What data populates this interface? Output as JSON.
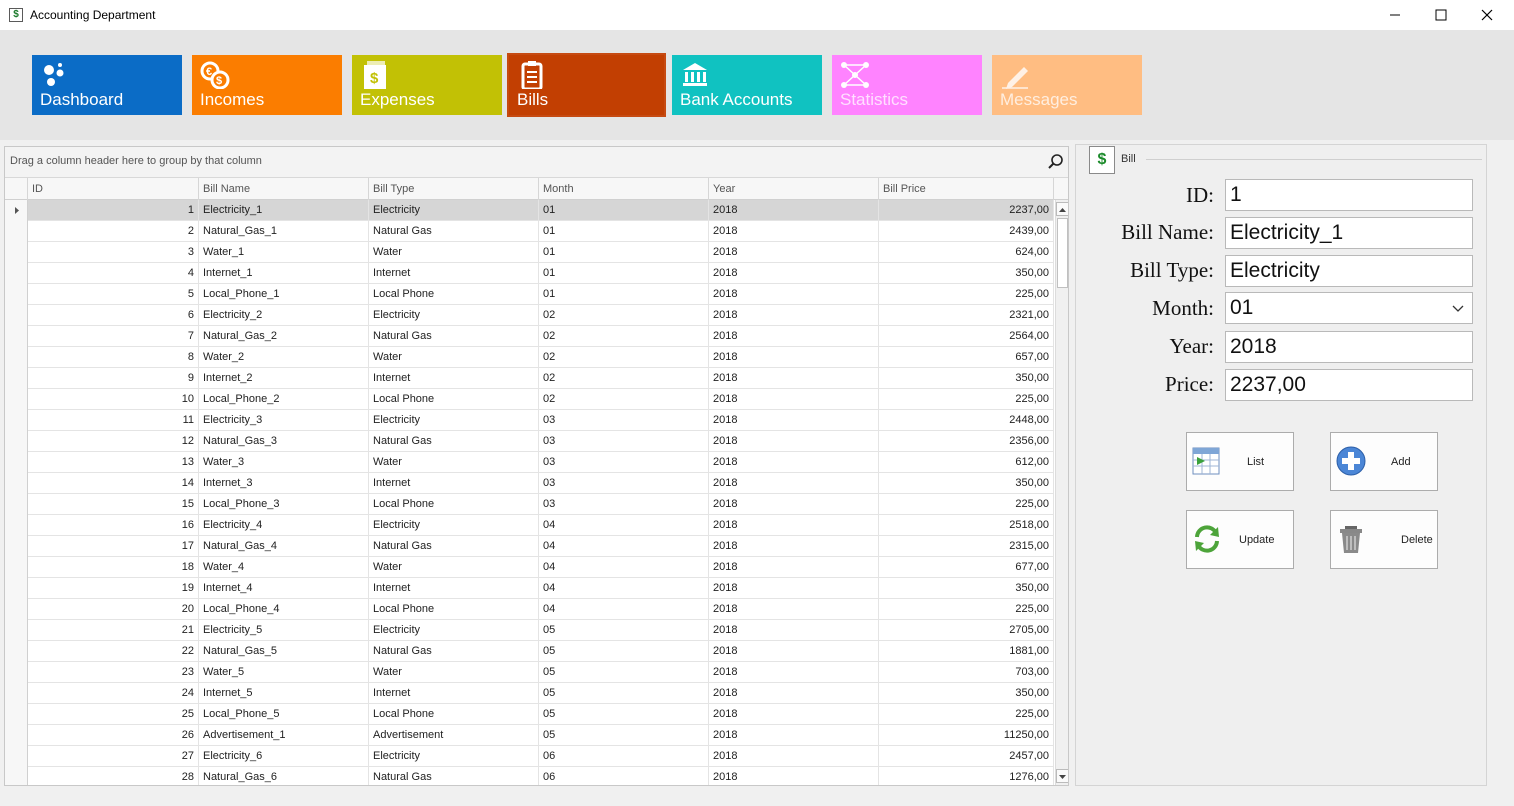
{
  "window": {
    "title": "Accounting Department",
    "icon_glyph": "$"
  },
  "nav": {
    "tiles": [
      {
        "label": "Dashboard",
        "color": "#0b6cc6",
        "icon": "dots-icon"
      },
      {
        "label": "Incomes",
        "color": "#fb7d00",
        "icon": "coins-icon"
      },
      {
        "label": "Expenses",
        "color": "#c2c105",
        "icon": "money-doc-icon"
      },
      {
        "label": "Bills",
        "color": "#c23f02",
        "icon": "clipboard-icon",
        "selected": true
      },
      {
        "label": "Bank Accounts",
        "color": "#10c2c1",
        "icon": "bank-icon"
      },
      {
        "label": "Statistics",
        "color": "#ff83ff",
        "icon": "network-icon"
      },
      {
        "label": "Messages",
        "color": "#ffbd82",
        "icon": "pencil-icon"
      }
    ]
  },
  "grid": {
    "group_panel_text": "Drag a column header here to group by that column",
    "columns": [
      "ID",
      "Bill Name",
      "Bill Type",
      "Month",
      "Year",
      "Bill Price"
    ],
    "rows": [
      [
        "1",
        "Electricity_1",
        "Electricity",
        "01",
        "2018",
        "2237,00"
      ],
      [
        "2",
        "Natural_Gas_1",
        "Natural Gas",
        "01",
        "2018",
        "2439,00"
      ],
      [
        "3",
        "Water_1",
        "Water",
        "01",
        "2018",
        "624,00"
      ],
      [
        "4",
        "Internet_1",
        "Internet",
        "01",
        "2018",
        "350,00"
      ],
      [
        "5",
        "Local_Phone_1",
        "Local Phone",
        "01",
        "2018",
        "225,00"
      ],
      [
        "6",
        "Electricity_2",
        "Electricity",
        "02",
        "2018",
        "2321,00"
      ],
      [
        "7",
        "Natural_Gas_2",
        "Natural Gas",
        "02",
        "2018",
        "2564,00"
      ],
      [
        "8",
        "Water_2",
        "Water",
        "02",
        "2018",
        "657,00"
      ],
      [
        "9",
        "Internet_2",
        "Internet",
        "02",
        "2018",
        "350,00"
      ],
      [
        "10",
        "Local_Phone_2",
        "Local Phone",
        "02",
        "2018",
        "225,00"
      ],
      [
        "11",
        "Electricity_3",
        "Electricity",
        "03",
        "2018",
        "2448,00"
      ],
      [
        "12",
        "Natural_Gas_3",
        "Natural Gas",
        "03",
        "2018",
        "2356,00"
      ],
      [
        "13",
        "Water_3",
        "Water",
        "03",
        "2018",
        "612,00"
      ],
      [
        "14",
        "Internet_3",
        "Internet",
        "03",
        "2018",
        "350,00"
      ],
      [
        "15",
        "Local_Phone_3",
        "Local Phone",
        "03",
        "2018",
        "225,00"
      ],
      [
        "16",
        "Electricity_4",
        "Electricity",
        "04",
        "2018",
        "2518,00"
      ],
      [
        "17",
        "Natural_Gas_4",
        "Natural Gas",
        "04",
        "2018",
        "2315,00"
      ],
      [
        "18",
        "Water_4",
        "Water",
        "04",
        "2018",
        "677,00"
      ],
      [
        "19",
        "Internet_4",
        "Internet",
        "04",
        "2018",
        "350,00"
      ],
      [
        "20",
        "Local_Phone_4",
        "Local Phone",
        "04",
        "2018",
        "225,00"
      ],
      [
        "21",
        "Electricity_5",
        "Electricity",
        "05",
        "2018",
        "2705,00"
      ],
      [
        "22",
        "Natural_Gas_5",
        "Natural Gas",
        "05",
        "2018",
        "1881,00"
      ],
      [
        "23",
        "Water_5",
        "Water",
        "05",
        "2018",
        "703,00"
      ],
      [
        "24",
        "Internet_5",
        "Internet",
        "05",
        "2018",
        "350,00"
      ],
      [
        "25",
        "Local_Phone_5",
        "Local Phone",
        "05",
        "2018",
        "225,00"
      ],
      [
        "26",
        "Advertisement_1",
        "Advertisement",
        "05",
        "2018",
        "11250,00"
      ],
      [
        "27",
        "Electricity_6",
        "Electricity",
        "06",
        "2018",
        "2457,00"
      ],
      [
        "28",
        "Natural_Gas_6",
        "Natural Gas",
        "06",
        "2018",
        "1276,00"
      ]
    ]
  },
  "panel": {
    "title": "Bill",
    "icon_glyph": "$",
    "fields": {
      "id": {
        "label": "ID:",
        "value": "1"
      },
      "name": {
        "label": "Bill Name:",
        "value": "Electricity_1"
      },
      "type": {
        "label": "Bill Type:",
        "value": "Electricity"
      },
      "month": {
        "label": "Month:",
        "value": "01"
      },
      "year": {
        "label": "Year:",
        "value": "2018"
      },
      "price": {
        "label": "Price:",
        "value": "2237,00"
      }
    },
    "buttons": {
      "list": "List",
      "add": "Add",
      "update": "Update",
      "delete": "Delete"
    }
  }
}
